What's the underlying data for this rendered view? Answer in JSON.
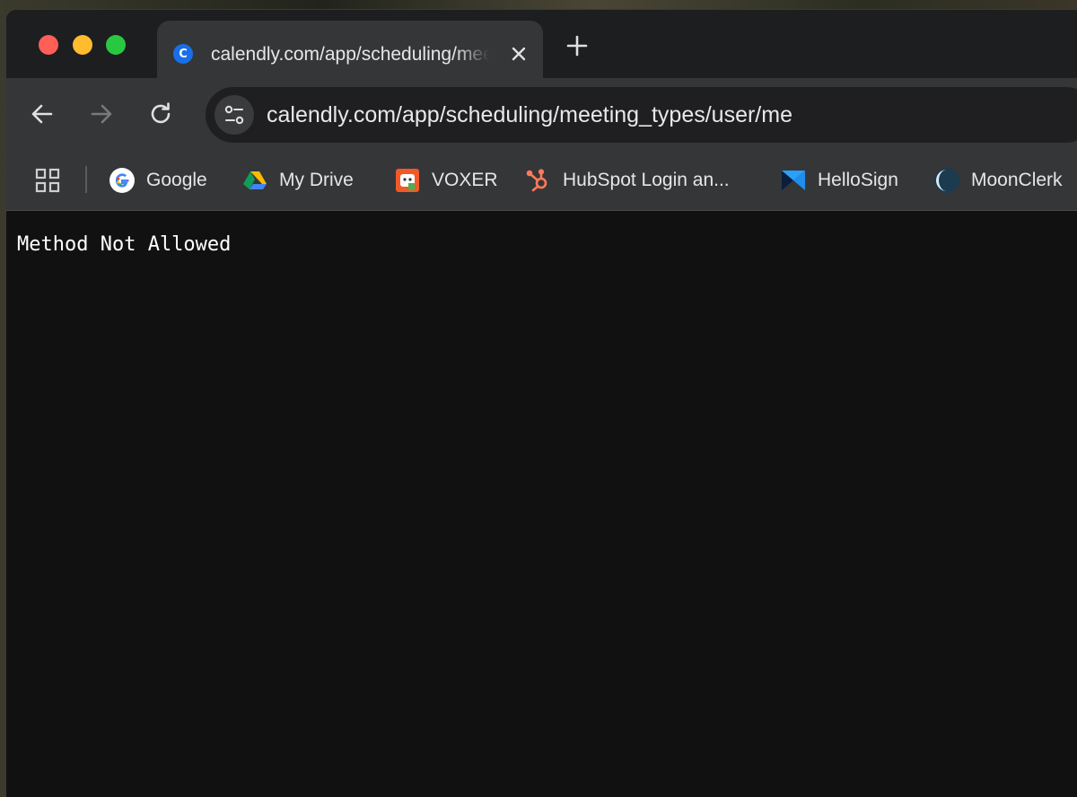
{
  "tab": {
    "title": "calendly.com/app/scheduling/meeting_types/user/me",
    "favicon": "calendly-icon"
  },
  "toolbar": {
    "url": "calendly.com/app/scheduling/meeting_types/user/me"
  },
  "bookmarks": [
    {
      "label": "Google",
      "icon": "google-icon"
    },
    {
      "label": "My Drive",
      "icon": "google-drive-icon"
    },
    {
      "label": "VOXER",
      "icon": "voxer-icon"
    },
    {
      "label": "HubSpot Login an...",
      "icon": "hubspot-icon"
    },
    {
      "label": "HelloSign",
      "icon": "hellosign-icon"
    },
    {
      "label": "MoonClerk",
      "icon": "moonclerk-icon"
    }
  ],
  "page": {
    "message": "Method Not Allowed"
  },
  "colors": {
    "tabstrip": "#1d1e20",
    "toolbar": "#353638",
    "page_bg": "#111111",
    "close": "#ff5f57",
    "minimize": "#febc2e",
    "maximize": "#28c840",
    "calendly_blue": "#1a6fe8",
    "hubspot_orange": "#ff7a59"
  }
}
